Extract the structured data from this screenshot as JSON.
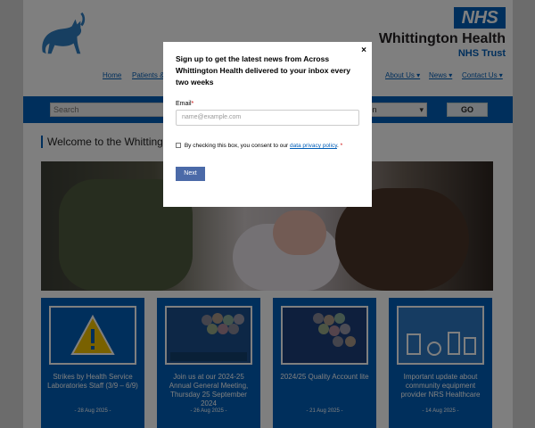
{
  "header": {
    "nhs_logo_text": "NHS",
    "org_name": "Whittington Health",
    "org_sub": "NHS Trust",
    "brand_color": "#005eb8",
    "logo_icon": "cat-icon"
  },
  "nav": {
    "items": [
      {
        "label": "Home"
      },
      {
        "label": "Patients &"
      },
      {
        "label": "About Us ▾"
      },
      {
        "label": "News ▾"
      },
      {
        "label": "Contact Us ▾"
      }
    ]
  },
  "search": {
    "placeholder": "Search",
    "select_value": "tion",
    "go_label": "GO"
  },
  "main": {
    "welcome_title": "Welcome to the Whitting"
  },
  "cards": [
    {
      "title": "Strikes by Health Service Laboratories Staff (3/9 – 6/9)",
      "date": "- 28 Aug 2025 -",
      "thumb": "warning-icon"
    },
    {
      "title": "Join us at our 2024-25 Annual General Meeting, Thursday 25 September 2024",
      "date": "- 26 Aug 2025 -",
      "thumb": "agm-poster"
    },
    {
      "title": "2024/25 Quality Account lite",
      "date": "- 21 Aug 2025 -",
      "thumb": "quality-account-poster"
    },
    {
      "title": "Important update about community equipment provider NRS Healthcare",
      "date": "- 14 Aug 2025 -",
      "thumb": "equipment-poster"
    }
  ],
  "modal": {
    "close_label": "×",
    "heading": "Sign up to get the latest news from Across Whittington Health delivered to your inbox every two weeks",
    "email_label": "Email",
    "required_mark": "*",
    "email_placeholder": "name@example.com",
    "consent_text": "By checking this box, you consent to our",
    "consent_link": "data privacy policy",
    "consent_end": ".",
    "next_label": "Next"
  }
}
